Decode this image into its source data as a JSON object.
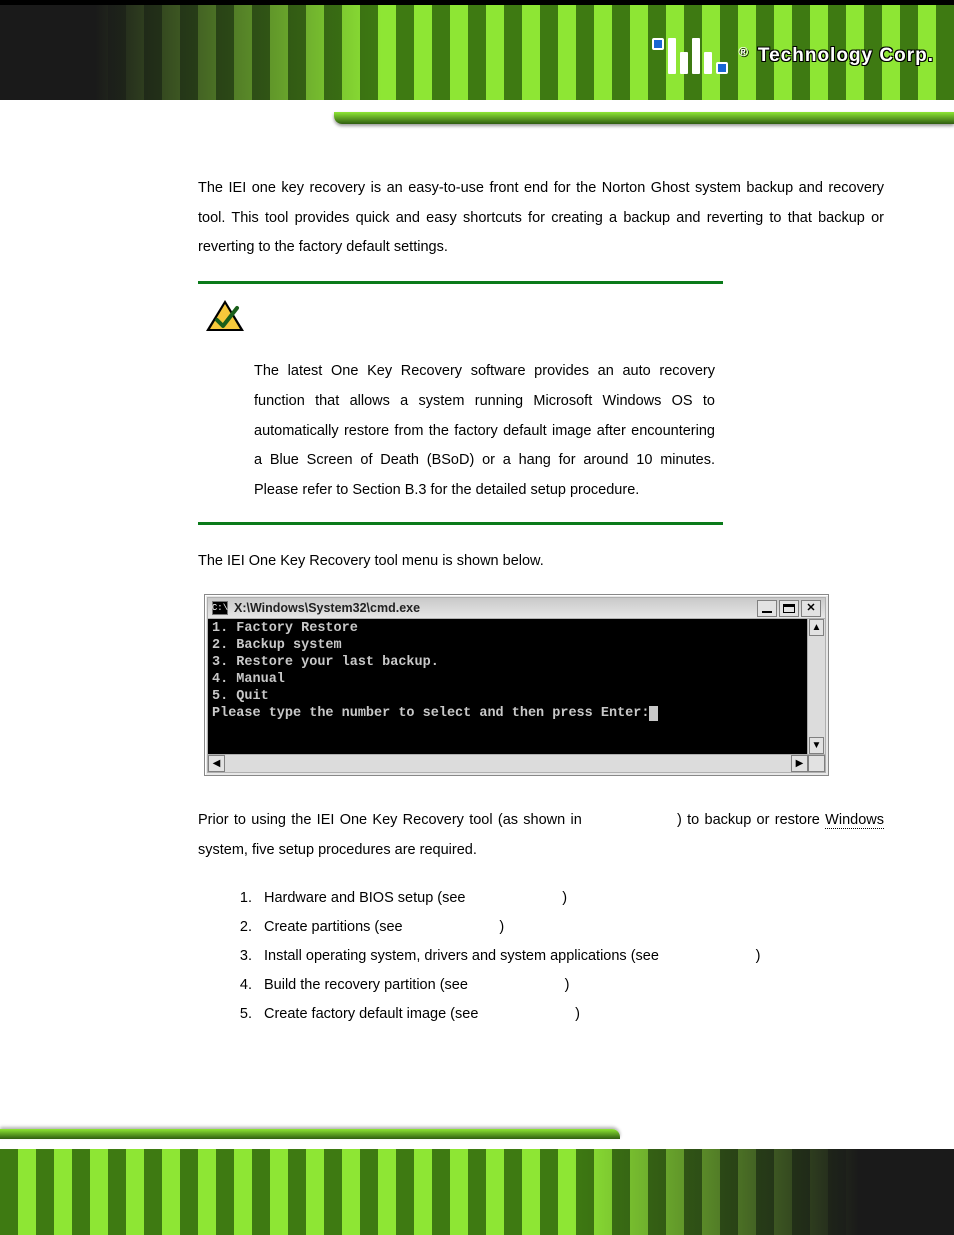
{
  "header": {
    "brand_prefix": "®",
    "brand_label": "Technology Corp."
  },
  "intro": "The IEI one key recovery is an easy-to-use front end for the Norton Ghost system backup and recovery tool. This tool provides quick and easy shortcuts for creating a backup and reverting to that backup or reverting to the factory default settings.",
  "note": "The latest One Key Recovery software provides an auto recovery function that allows a system running Microsoft Windows OS to automatically restore from the factory default image after encountering a Blue Screen of Death (BSoD) or a hang for around 10 minutes. Please refer to Section B.3 for the detailed setup procedure.",
  "after_note": "The IEI One Key Recovery tool menu is shown below.",
  "cmd": {
    "title": "X:\\Windows\\System32\\cmd.exe",
    "icon_label": "C:\\",
    "lines": [
      "1. Factory Restore",
      "2. Backup system",
      "3. Restore your last backup.",
      "4. Manual",
      "5. Quit",
      "Please type the number to select and then press Enter:"
    ]
  },
  "prior": {
    "pre": "Prior to using the IEI One Key Recovery tool (as shown in ",
    "mid": ") to backup or restore ",
    "win": "Windows",
    "post": " system, five setup procedures are required."
  },
  "steps": [
    {
      "pre": "Hardware and BIOS setup (see ",
      "post": ")"
    },
    {
      "pre": "Create partitions (see ",
      "post": ")"
    },
    {
      "pre": "Install operating system, drivers and system applications (see ",
      "post": ")"
    },
    {
      "pre": "Build the recovery partition (see ",
      "post": ")"
    },
    {
      "pre": "Create factory default image (see ",
      "post": ")"
    }
  ],
  "step_gaps": [
    "                       ",
    "                       ",
    "                       ",
    "                       ",
    "                       "
  ],
  "prior_gap": "                 "
}
